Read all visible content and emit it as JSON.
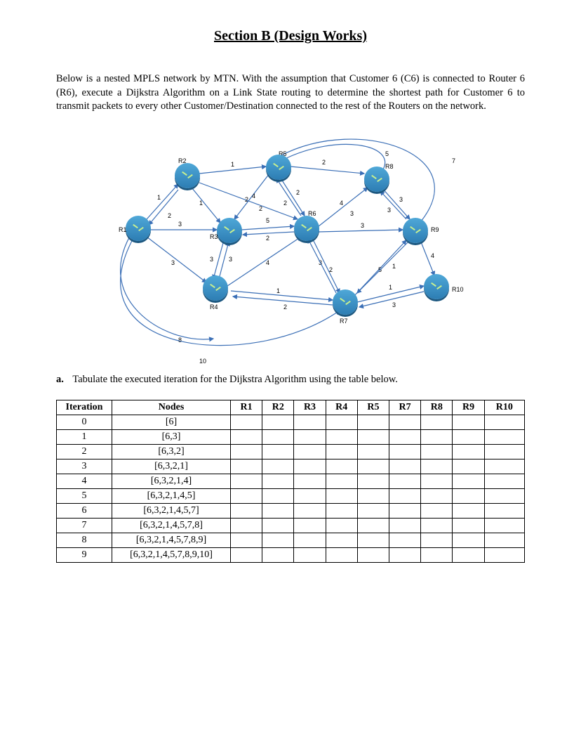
{
  "title": "Section B (Design Works)",
  "intro": "Below is a nested MPLS network by MTN. With the assumption that Customer 6 (C6) is connected to Router 6 (R6), execute a Dijkstra Algorithm on a Link State routing to determine the shortest path for Customer 6 to transmit packets to every other Customer/Destination connected to the rest of the Routers on the network.",
  "diagram": {
    "routers": {
      "R1": "R1",
      "R2": "R2",
      "R3": "R3",
      "R4": "R4",
      "R5": "R5",
      "R6": "R6",
      "R7": "R7",
      "R8": "R8",
      "R9": "R9",
      "R10": "R10"
    },
    "edgeWeights": {
      "r2_r5": "1",
      "r5_r8": "2",
      "r5_r6_a": "2",
      "r5_r6_b": "2",
      "r2_r3": "1",
      "r2_r6": "2",
      "r1_r2_a": "1",
      "r1_r2_b": "2",
      "r3_r6_a": "5",
      "r3_r6_b": "2",
      "r1_r3": "3",
      "r1_r4": "3",
      "r3_r4_a": "3",
      "r3_r4_b": "3",
      "r5_r3": "4",
      "r6_r8": "4",
      "r6_r7_a": "3",
      "r6_r7_b": "2",
      "r6_r9": "3",
      "r8_r9_a": "3",
      "r8_r9_b": "3",
      "r4_r6": "4",
      "r4_r7_a": "1",
      "r4_r7_b": "2",
      "r7_r9_a": "5",
      "r7_r9_b": "1",
      "r7_r10_a": "1",
      "r7_r10_b": "3",
      "r9_r10": "4",
      "r1_r4_loop": "8",
      "r1_r7_loop": "10",
      "r5_r8_loop": "7",
      "r5_r9_loop": "5",
      "r5_r3_short": "2"
    }
  },
  "question": {
    "letter": "a.",
    "text": "Tabulate the executed iteration for the Dijkstra Algorithm using the table below."
  },
  "table": {
    "headers": {
      "iteration": "Iteration",
      "nodes": "Nodes",
      "r1": "R1",
      "r2": "R2",
      "r3": "R3",
      "r4": "R4",
      "r5": "R5",
      "r7": "R7",
      "r8": "R8",
      "r9": "R9",
      "r10": "R10"
    },
    "rows": [
      {
        "iter": "0",
        "nodes": "[6]"
      },
      {
        "iter": "1",
        "nodes": "[6,3]"
      },
      {
        "iter": "2",
        "nodes": "[6,3,2]"
      },
      {
        "iter": "3",
        "nodes": "[6,3,2,1]"
      },
      {
        "iter": "4",
        "nodes": "[6,3,2,1,4]"
      },
      {
        "iter": "5",
        "nodes": "[6,3,2,1,4,5]"
      },
      {
        "iter": "6",
        "nodes": "[6,3,2,1,4,5,7]"
      },
      {
        "iter": "7",
        "nodes": "[6,3,2,1,4,5,7,8]"
      },
      {
        "iter": "8",
        "nodes": "[6,3,2,1,4,5,7,8,9]"
      },
      {
        "iter": "9",
        "nodes": "[6,3,2,1,4,5,7,8,9,10]"
      }
    ]
  }
}
